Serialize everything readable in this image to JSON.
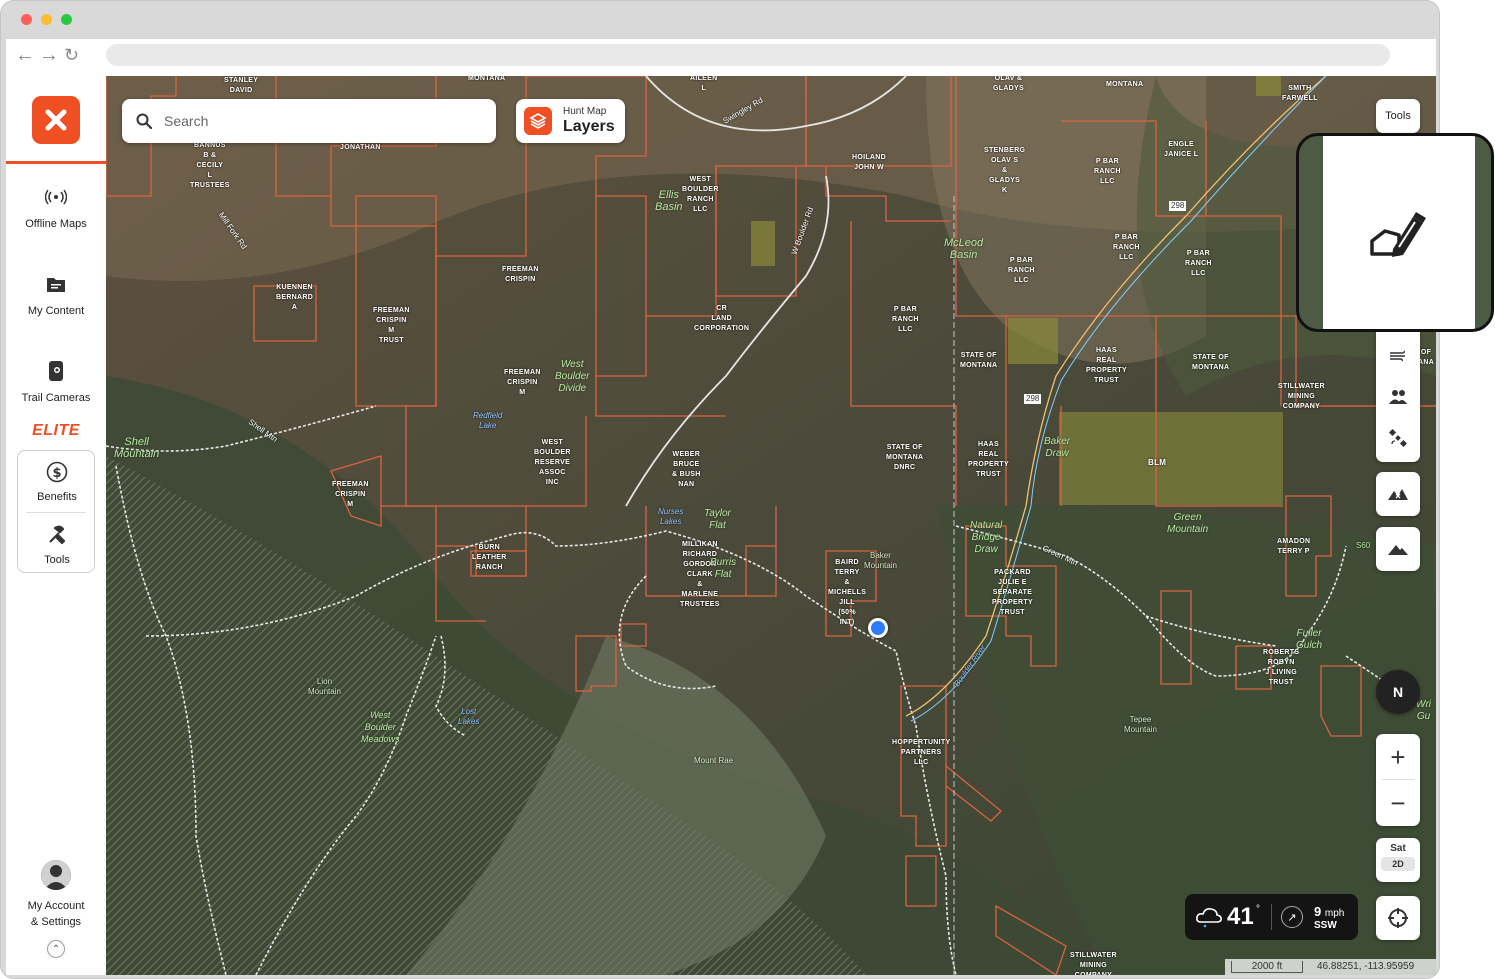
{
  "browser": {
    "traffic_lights": [
      "close",
      "minimize",
      "maximize"
    ]
  },
  "sidebar": {
    "offline_maps": "Offline Maps",
    "my_content": "My Content",
    "trail_cameras": "Trail Cameras",
    "elite": "ELITE",
    "benefits": "Benefits",
    "tools": "Tools",
    "account_line1": "My Account",
    "account_line2": "& Settings"
  },
  "search": {
    "placeholder": "Search"
  },
  "layers": {
    "line1": "Hunt Map",
    "line2": "Layers"
  },
  "right_controls": {
    "tools_label": "Tools",
    "compass": "N",
    "zoom_in": "+",
    "zoom_out": "−",
    "basemap": "Sat",
    "view_mode": "2D"
  },
  "weather": {
    "temp": "41",
    "deg": "°",
    "wind_speed": "9",
    "wind_unit": "mph",
    "wind_dir": "SSW"
  },
  "scale": {
    "distance": "2000 ft",
    "coords": "46.88251, -113.95959"
  },
  "map": {
    "owner_labels": [
      {
        "t": "STANLEY\nDAVID"
      },
      {
        "t": "MONTANA"
      },
      {
        "t": "AILEEN\nL"
      },
      {
        "t": "OLAV &\nGLADYS"
      },
      {
        "t": "MONTANA"
      },
      {
        "t": "SMITH\nFARWELL"
      },
      {
        "t": "BANNUS\nB &\nCECILY\nL\nTRUSTEES"
      },
      {
        "t": "JONATHAN"
      },
      {
        "t": "HOILAND\nJOHN W"
      },
      {
        "t": "STENBERG\nOLAV S\n&\nGLADYS\nK"
      },
      {
        "t": "P BAR\nRANCH\nLLC"
      },
      {
        "t": "ENGLE\nJANICE L"
      },
      {
        "t": "WEST\nBOULDER\nRANCH\nLLC"
      },
      {
        "t": "P BAR\nRANCH\nLLC"
      },
      {
        "t": "P BAR\nRANCH\nLLC"
      },
      {
        "t": "P BAR\nRANCH\nLLC"
      },
      {
        "t": "FREEMAN\nCRISPIN"
      },
      {
        "t": "KUENNEN\nBERNARD\nA"
      },
      {
        "t": "FREEMAN\nCRISPIN\nM\nTRUST"
      },
      {
        "t": "CR\nLAND\nCORPORATION"
      },
      {
        "t": "P BAR\nRANCH\nLLC"
      },
      {
        "t": "STATE OF\nMONTANA"
      },
      {
        "t": "HAAS\nREAL\nPROPERTY\nTRUST"
      },
      {
        "t": "STATE OF\nMONTANA"
      },
      {
        "t": "STILLWATER\nMINING\nCOMPANY"
      },
      {
        "t": "FREEMAN\nCRISPIN\nM"
      },
      {
        "t": "WEST\nBOULDER\nRESERVE\nASSOC\nINC"
      },
      {
        "t": "WEBER\nBRUCE\n& BUSH\nNAN"
      },
      {
        "t": "STATE OF\nMONTANA\nDNRC"
      },
      {
        "t": "HAAS\nREAL\nPROPERTY\nTRUST"
      },
      {
        "t": "BLM"
      },
      {
        "t": "FREEMAN\nCRISPIN\nM"
      },
      {
        "t": "BURN\nLEATHER\nRANCH"
      },
      {
        "t": "MILLIKAN\nRICHARD\nGORDON\nCLARK\n&\nMARLENE\nTRUSTEES"
      },
      {
        "t": "BAIRD\nTERRY\n&\nMICHELLS\nJILL\n(50%\nINT)"
      },
      {
        "t": "PACKARD\nJULIE E\nSEPARATE\nPROPERTY\nTRUST"
      },
      {
        "t": "AMADON\nTERRY P"
      },
      {
        "t": "ROBERTS\nROBYN\nJ LIVING\nTRUST"
      },
      {
        "t": "HOPPERTUNITY\nPARTNERS\nLLC"
      },
      {
        "t": "STILLWATER\nMINING\nCOMPANY"
      },
      {
        "t": "OF\nANA"
      }
    ],
    "place_labels": [
      {
        "t": "Ellis\nBasin"
      },
      {
        "t": "McLeod\nBasin"
      },
      {
        "t": "West\nBoulder\nDivide"
      },
      {
        "t": "Shell\nMountain"
      },
      {
        "t": "Taylor\nFlat"
      },
      {
        "t": "Burris\nFlat"
      },
      {
        "t": "Baker\nDraw"
      },
      {
        "t": "Green\nMountain"
      },
      {
        "t": "Natural\nBridge\nDraw"
      },
      {
        "t": "West\nBoulder\nMeadows"
      },
      {
        "t": "Fuller\nGulch"
      },
      {
        "t": "Wri\nGu"
      }
    ],
    "water_labels": [
      {
        "t": "Redfield\nLake"
      },
      {
        "t": "Nurses\nLakes"
      },
      {
        "t": "Lost\nLakes"
      },
      {
        "t": "Boulder River"
      }
    ],
    "peak_labels": [
      {
        "t": "Baker\nMountain"
      },
      {
        "t": "Lion\nMountain"
      },
      {
        "t": "Mount Rae"
      },
      {
        "t": "Tepee\nMountain"
      },
      {
        "t": "S60"
      }
    ],
    "roads": [
      {
        "t": "Swingley Rd"
      },
      {
        "t": "Mill Fork Rd"
      },
      {
        "t": "W Boulder Rd"
      },
      {
        "t": "Shell Mtn"
      },
      {
        "t": "Green Mtn"
      },
      {
        "t": "298"
      },
      {
        "t": "298"
      }
    ]
  }
}
